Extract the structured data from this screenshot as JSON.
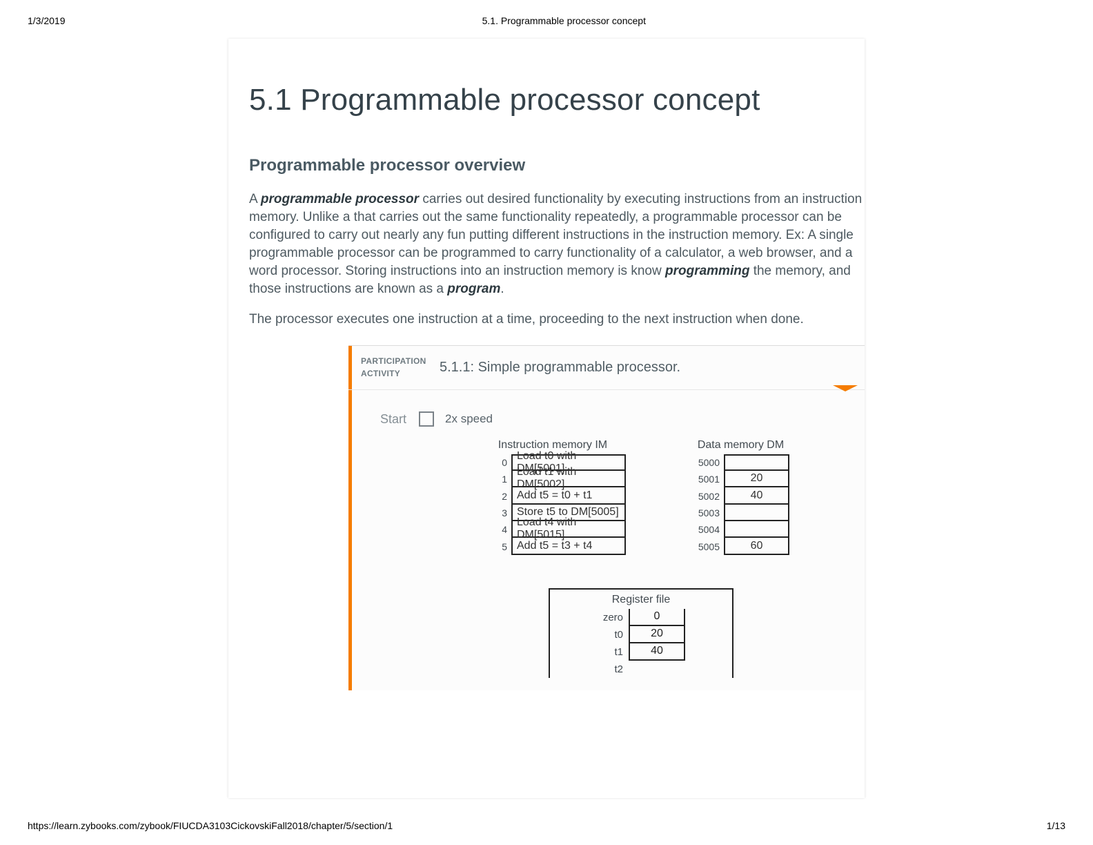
{
  "print": {
    "date": "1/3/2019",
    "doc_title": "5.1. Programmable processor concept",
    "url": "https://learn.zybooks.com/zybook/FIUCDA3103CickovskiFall2018/chapter/5/section/1",
    "page": "1/13"
  },
  "title": "5.1 Programmable processor concept",
  "section": "Programmable processor overview",
  "para1_a": "A ",
  "para1_b1": "programmable processor",
  "para1_c": " carries out desired functionality by executing instructions from an instruction memory. Unlike a that carries out the same functionality repeatedly, a programmable processor can be configured to carry out nearly any fun putting different instructions in the instruction memory. Ex: A single programmable processor can be programmed to carry functionality of a calculator, a web browser, and a word processor. Storing instructions into an instruction memory is know ",
  "para1_b2": "programming",
  "para1_d": " the memory, and those instructions are known as a ",
  "para1_b3": "program",
  "para1_e": ".",
  "para2": "The processor executes one instruction at a time, proceeding to the next instruction when done.",
  "activity": {
    "label_l1": "PARTICIPATION",
    "label_l2": "ACTIVITY",
    "title": "5.1.1: Simple programmable processor.",
    "start": "Start",
    "speed": "2x speed",
    "im_title": "Instruction memory IM",
    "dm_title": "Data memory DM",
    "rf_title": "Register file",
    "im": [
      {
        "i": "0",
        "v": "Load t0 with DM[5001]"
      },
      {
        "i": "1",
        "v": "Load t1 with DM[5002]"
      },
      {
        "i": "2",
        "v": "Add t5 = t0 + t1"
      },
      {
        "i": "3",
        "v": "Store t5 to DM[5005]"
      },
      {
        "i": "4",
        "v": "Load t4 with DM[5015]"
      },
      {
        "i": "5",
        "v": "Add t5 = t3 + t4"
      }
    ],
    "dm": [
      {
        "i": "5000",
        "v": ""
      },
      {
        "i": "5001",
        "v": "20"
      },
      {
        "i": "5002",
        "v": "40"
      },
      {
        "i": "5003",
        "v": ""
      },
      {
        "i": "5004",
        "v": ""
      },
      {
        "i": "5005",
        "v": "60"
      }
    ],
    "rf": [
      {
        "i": "zero",
        "v": "0"
      },
      {
        "i": "t0",
        "v": "20"
      },
      {
        "i": "t1",
        "v": "40"
      },
      {
        "i": "t2",
        "v": null
      }
    ]
  }
}
